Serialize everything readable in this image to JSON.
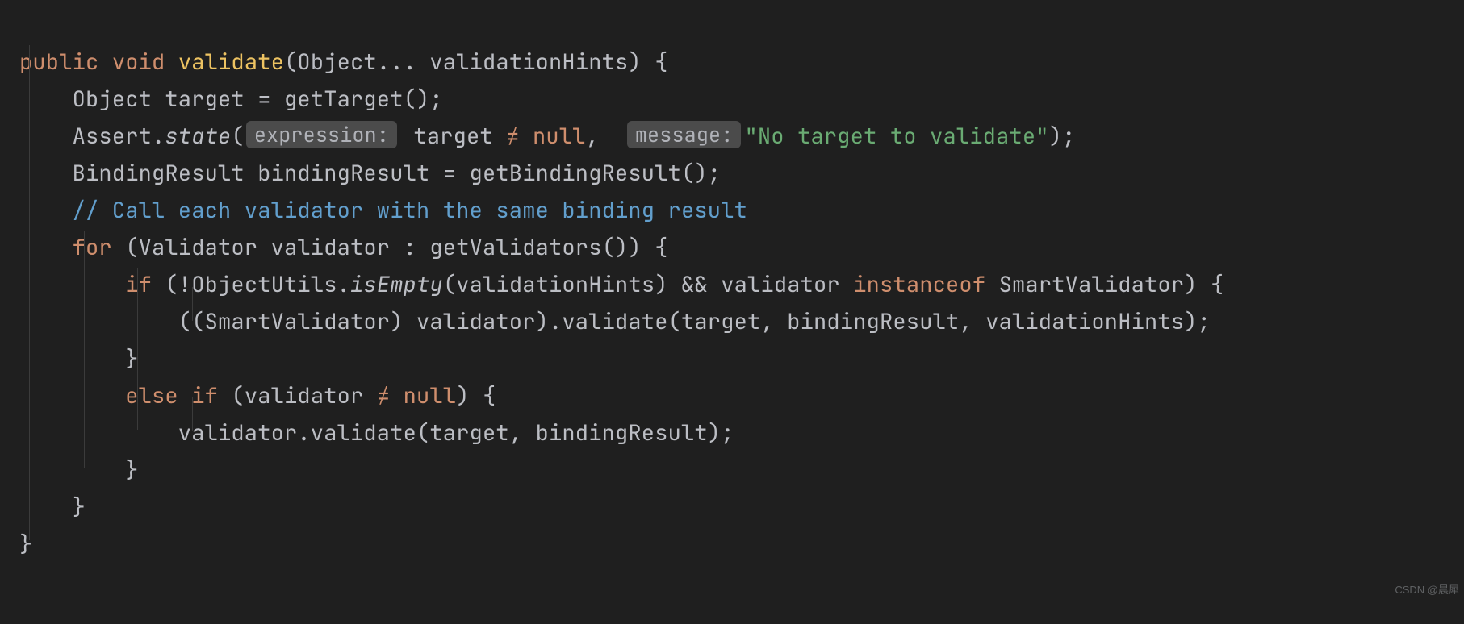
{
  "code": {
    "l1": {
      "kw1": "public",
      "kw2": "void",
      "name": "validate",
      "p1": "(Object... validationHints) {"
    },
    "l2": {
      "t": "    Object target = getTarget();"
    },
    "l3": {
      "a": "    Assert.",
      "m": "state",
      "p1": "(",
      "h1": "expression:",
      "e1": " target ",
      "ne": "≠",
      "e2": " ",
      "nul": "null",
      "c": ", ",
      "h2": "message:",
      "s": "\"No target to validate\"",
      "end": ");"
    },
    "l4": {
      "t": "    BindingResult bindingResult = getBindingResult();"
    },
    "l5": {
      "t": "    // Call each validator with the same binding result"
    },
    "l6": {
      "kw": "for",
      "t": " (Validator validator : getValidators()) {"
    },
    "l7": {
      "kw": "if",
      "t1": " (!ObjectUtils.",
      "m": "isEmpty",
      "t2": "(validationHints) && validator ",
      "kw2": "instanceof",
      "t3": " SmartValidator) {"
    },
    "l8": {
      "t": "            ((SmartValidator) validator).validate(target, bindingResult, validationHints);"
    },
    "l9": {
      "t": "        }"
    },
    "l10": {
      "kw1": "else",
      "kw2": "if",
      "t1": " (validator ",
      "ne": "≠",
      "t2": " ",
      "nul": "null",
      "t3": ") {"
    },
    "l11": {
      "t": "            validator.validate(target, bindingResult);"
    },
    "l12": {
      "t": "        }"
    },
    "l13": {
      "t": "    }"
    },
    "l14": {
      "t": "}"
    }
  },
  "watermark": "CSDN @晨犀"
}
